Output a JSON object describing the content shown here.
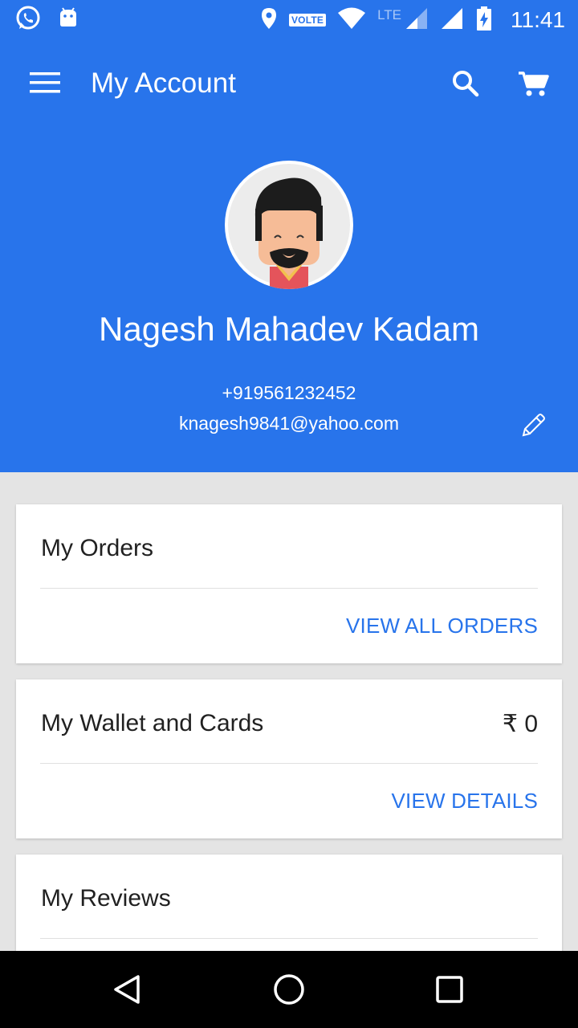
{
  "status_bar": {
    "left_icons": [
      "whatsapp-icon",
      "android-icon"
    ],
    "right_icons": [
      "location-icon",
      "volte-badge",
      "wifi-icon",
      "lte-signal-icon",
      "signal-icon",
      "battery-charging-icon"
    ],
    "volte_label": "VOLTE",
    "lte_label": "LTE",
    "time": "11:41"
  },
  "app_bar": {
    "title": "My Account",
    "icons": [
      "menu-icon",
      "search-icon",
      "cart-icon"
    ],
    "background_color": "#2874eb"
  },
  "profile": {
    "name": "Nagesh Mahadev Kadam",
    "phone": "+919561232452",
    "email": "knagesh9841@yahoo.com",
    "avatar_icon": "avatar-illustration",
    "edit_icon": "pencil-icon"
  },
  "cards": {
    "orders": {
      "title": "My Orders",
      "action": "VIEW ALL ORDERS"
    },
    "wallet": {
      "title": "My Wallet and Cards",
      "value": "₹ 0",
      "action": "VIEW DETAILS"
    },
    "reviews": {
      "title": "My Reviews"
    }
  },
  "nav_bar": {
    "icons": [
      "back-icon",
      "home-icon",
      "recents-icon"
    ]
  },
  "colors": {
    "accent": "#2874eb",
    "page_background": "#e4e4e4",
    "card_background": "#ffffff",
    "text_primary": "#212121"
  }
}
